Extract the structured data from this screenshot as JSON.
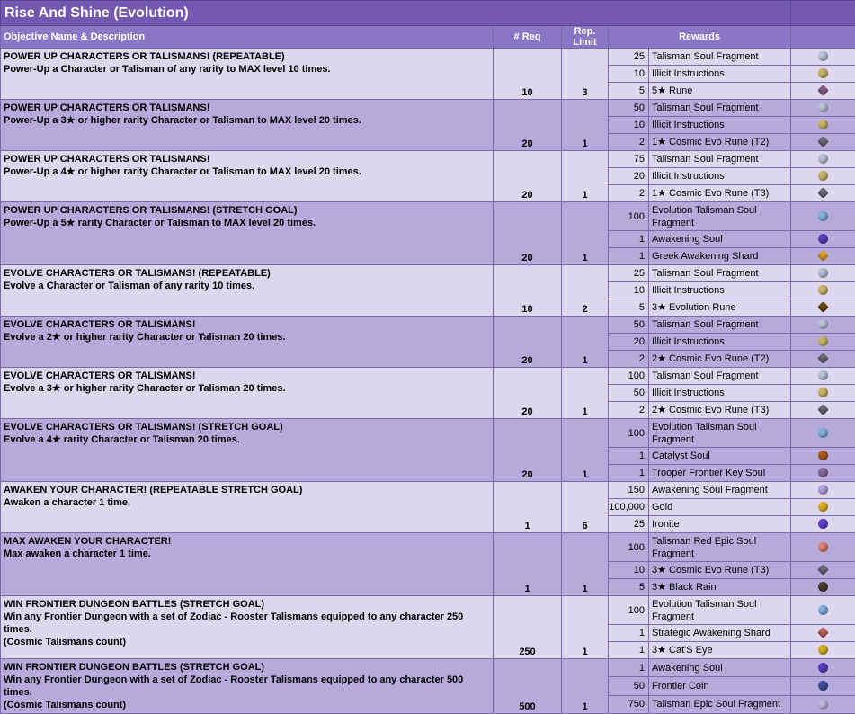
{
  "title": "Rise And Shine (Evolution)",
  "headers": {
    "objective": "Objective Name & Description",
    "req": "# Req",
    "limit": "Rep. Limit",
    "rewards": "Rewards"
  },
  "objectives": [
    {
      "name": "POWER UP CHARACTERS OR TALISMANS! (REPEATABLE)",
      "desc": "Power-Up a Character or Talisman of any rarity to MAX level 10 times.",
      "req": "10",
      "limit": "3",
      "rewards": [
        {
          "amount": "25",
          "name": "Talisman Soul Fragment",
          "icon": "soul-fragment-icon",
          "color": "#b8c4d6"
        },
        {
          "amount": "10",
          "name": "Illicit Instructions",
          "icon": "scroll-icon",
          "color": "#c9b46a"
        },
        {
          "amount": "5",
          "name": "5★ Rune",
          "icon": "rune-icon",
          "color": "#8a5a8a"
        }
      ]
    },
    {
      "name": "POWER UP CHARACTERS OR TALISMANS!",
      "desc": "Power-Up a 3★ or higher rarity Character or Talisman to MAX level 20 times.",
      "req": "20",
      "limit": "1",
      "rewards": [
        {
          "amount": "50",
          "name": "Talisman Soul Fragment",
          "icon": "soul-fragment-icon",
          "color": "#b8c4d6"
        },
        {
          "amount": "10",
          "name": "Illicit Instructions",
          "icon": "scroll-icon",
          "color": "#c9b46a"
        },
        {
          "amount": "2",
          "name": "1★ Cosmic Evo Rune (T2)",
          "icon": "cosmic-rune-icon",
          "color": "#6a6a78"
        }
      ]
    },
    {
      "name": "POWER UP CHARACTERS OR TALISMANS!",
      "desc": "Power-Up a 4★ or higher rarity Character or Talisman to MAX level 20 times.",
      "req": "20",
      "limit": "1",
      "rewards": [
        {
          "amount": "75",
          "name": "Talisman Soul Fragment",
          "icon": "soul-fragment-icon",
          "color": "#b8c4d6"
        },
        {
          "amount": "20",
          "name": "Illicit Instructions",
          "icon": "scroll-icon",
          "color": "#c9b46a"
        },
        {
          "amount": "2",
          "name": "1★ Cosmic Evo Rune (T3)",
          "icon": "cosmic-rune-icon",
          "color": "#6a6a78"
        }
      ]
    },
    {
      "name": "POWER UP CHARACTERS OR TALISMANS! (STRETCH GOAL)",
      "desc": "Power-Up a 5★ rarity Character or Talisman to MAX level 20 times.",
      "req": "20",
      "limit": "1",
      "rewards": [
        {
          "amount": "100",
          "name": "Evolution Talisman Soul Fragment",
          "icon": "evo-soul-fragment-icon",
          "color": "#7fb0e0",
          "tall": true
        },
        {
          "amount": "1",
          "name": "Awakening Soul",
          "icon": "awakening-soul-icon",
          "color": "#5a3fc0"
        },
        {
          "amount": "1",
          "name": "Greek Awakening Shard",
          "icon": "shard-icon",
          "color": "#e0a020"
        }
      ]
    },
    {
      "name": "EVOLVE CHARACTERS OR TALISMANS! (REPEATABLE)",
      "desc": "Evolve a Character or Talisman of any rarity 10 times.",
      "req": "10",
      "limit": "2",
      "rewards": [
        {
          "amount": "25",
          "name": "Talisman Soul Fragment",
          "icon": "soul-fragment-icon",
          "color": "#b8c4d6"
        },
        {
          "amount": "10",
          "name": "Illicit Instructions",
          "icon": "scroll-icon",
          "color": "#c9b46a"
        },
        {
          "amount": "5",
          "name": "3★ Evolution Rune",
          "icon": "evolution-rune-icon",
          "color": "#6a4a10"
        }
      ]
    },
    {
      "name": "EVOLVE CHARACTERS OR TALISMANS!",
      "desc": "Evolve a 2★ or higher rarity Character or Talisman 20 times.",
      "req": "20",
      "limit": "1",
      "rewards": [
        {
          "amount": "50",
          "name": "Talisman Soul Fragment",
          "icon": "soul-fragment-icon",
          "color": "#b8c4d6"
        },
        {
          "amount": "20",
          "name": "Illicit Instructions",
          "icon": "scroll-icon",
          "color": "#c9b46a"
        },
        {
          "amount": "2",
          "name": "2★ Cosmic Evo Rune (T2)",
          "icon": "cosmic-rune-icon",
          "color": "#6a6a78"
        }
      ]
    },
    {
      "name": "EVOLVE CHARACTERS OR TALISMANS!",
      "desc": "Evolve a 3★ or higher rarity Character or Talisman 20 times.",
      "req": "20",
      "limit": "1",
      "rewards": [
        {
          "amount": "100",
          "name": "Talisman Soul Fragment",
          "icon": "soul-fragment-icon",
          "color": "#b8c4d6"
        },
        {
          "amount": "50",
          "name": "Illicit Instructions",
          "icon": "scroll-icon",
          "color": "#c9b46a"
        },
        {
          "amount": "2",
          "name": "2★ Cosmic Evo Rune (T3)",
          "icon": "cosmic-rune-icon",
          "color": "#6a6a78"
        }
      ]
    },
    {
      "name": "EVOLVE CHARACTERS OR TALISMANS! (STRETCH GOAL)",
      "desc": "Evolve a 4★ rarity Character or Talisman 20 times.",
      "req": "20",
      "limit": "1",
      "rewards": [
        {
          "amount": "100",
          "name": "Evolution Talisman Soul Fragment",
          "icon": "evo-soul-fragment-icon",
          "color": "#7fb0e0",
          "tall": true
        },
        {
          "amount": "1",
          "name": "Catalyst Soul",
          "icon": "catalyst-soul-icon",
          "color": "#b05a20"
        },
        {
          "amount": "1",
          "name": "Trooper Frontier Key Soul",
          "icon": "key-soul-icon",
          "color": "#8a6a9a"
        }
      ]
    },
    {
      "name": "AWAKEN YOUR CHARACTER! (REPEATABLE STRETCH GOAL)",
      "desc": "Awaken a character 1 time.",
      "req": "1",
      "limit": "6",
      "rewards": [
        {
          "amount": "150",
          "name": "Awakening Soul Fragment",
          "icon": "awakening-fragment-icon",
          "color": "#b0a0e0"
        },
        {
          "amount": "100,000",
          "name": "Gold",
          "icon": "gold-icon",
          "color": "#e0b020"
        },
        {
          "amount": "25",
          "name": "Ironite",
          "icon": "ironite-icon",
          "color": "#6040d0"
        }
      ]
    },
    {
      "name": "MAX AWAKEN YOUR CHARACTER!",
      "desc": "Max awaken a character 1 time.",
      "req": "1",
      "limit": "1",
      "rewards": [
        {
          "amount": "100",
          "name": "Talisman Red Epic Soul Fragment",
          "icon": "red-epic-soul-icon",
          "color": "#e08070",
          "tall": true
        },
        {
          "amount": "10",
          "name": "3★ Cosmic Evo Rune (T3)",
          "icon": "cosmic-rune-icon",
          "color": "#6a6a78"
        },
        {
          "amount": "5",
          "name": "3★ Black Rain",
          "icon": "black-rain-icon",
          "color": "#4a3a2a"
        }
      ]
    },
    {
      "name": "WIN FRONTIER DUNGEON BATTLES (STRETCH GOAL)",
      "desc": "Win any Frontier Dungeon with a set of Zodiac - Rooster Talismans equipped to any character 250 times.",
      "note": "(Cosmic Talismans count)",
      "req": "250",
      "limit": "1",
      "rewards": [
        {
          "amount": "100",
          "name": "Evolution Talisman Soul Fragment",
          "icon": "evo-soul-fragment-icon",
          "color": "#7fb0e0",
          "tall": true
        },
        {
          "amount": "1",
          "name": "Strategic Awakening Shard",
          "icon": "strategic-shard-icon",
          "color": "#c06060"
        },
        {
          "amount": "1",
          "name": "3★ Cat'S Eye",
          "icon": "cats-eye-icon",
          "color": "#d0b020"
        }
      ]
    },
    {
      "name": "WIN FRONTIER DUNGEON BATTLES (STRETCH GOAL)",
      "desc": "Win any Frontier Dungeon with a set of Zodiac - Rooster Talismans equipped to any character 500 times.",
      "note": "(Cosmic Talismans count)",
      "req": "500",
      "limit": "1",
      "rewards": [
        {
          "amount": "1",
          "name": "Awakening Soul",
          "icon": "awakening-soul-icon",
          "color": "#5a3fc0"
        },
        {
          "amount": "50",
          "name": "Frontier Coin",
          "icon": "frontier-coin-icon",
          "color": "#4050a0"
        },
        {
          "amount": "750",
          "name": "Talisman Epic Soul Fragment",
          "icon": "epic-soul-fragment-icon",
          "color": "#c0b8e0"
        }
      ]
    }
  ]
}
